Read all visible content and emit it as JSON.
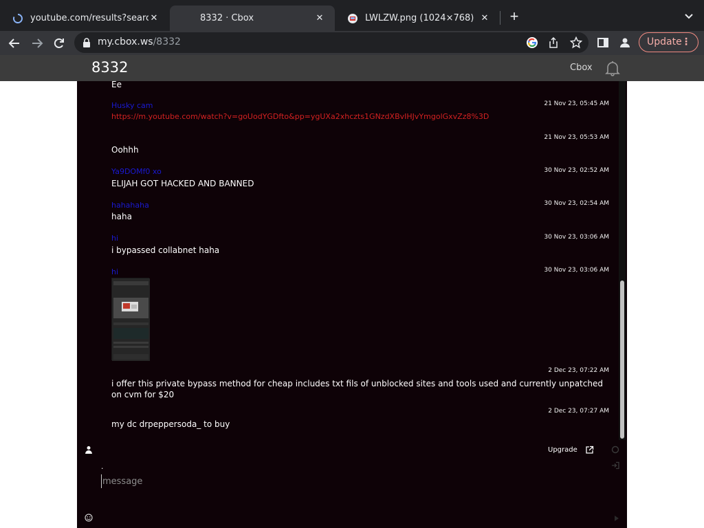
{
  "browser": {
    "tabs": [
      {
        "title": "youtube.com/results?search_q",
        "icon": "loading-spinner-icon",
        "active": false
      },
      {
        "title": "8332 · Cbox",
        "icon": "",
        "active": true
      },
      {
        "title": "LWLZW.png (1024×768)",
        "icon": "image-icon",
        "active": false
      }
    ],
    "url_host": "my.cbox.ws",
    "url_path": "/8332",
    "update_label": "Update"
  },
  "app": {
    "room_title": "8332",
    "brand": "Cbox"
  },
  "chat": {
    "top_partial_text": "Ee",
    "messages": [
      {
        "name": "Husky cam",
        "time": "21 Nov 23, 05:45 AM",
        "link": "https://m.youtube.com/watch?v=goUodYGDfto&pp=ygUXa2xhczts1GNzdXBvIHJvYmgolGxvZz8%3D"
      },
      {
        "name": "",
        "time": "21 Nov 23, 05:53 AM",
        "text": "Oohhh"
      },
      {
        "name": "Ya9DOMf0 xo",
        "time": "30 Nov 23, 02:52 AM",
        "text": "ELIJAH GOT HACKED AND BANNED"
      },
      {
        "name": "hahahaha",
        "time": "30 Nov 23, 02:54 AM",
        "text": "haha"
      },
      {
        "name": "hi",
        "time": "30 Nov 23, 03:06 AM",
        "text": "i bypassed collabnet haha"
      },
      {
        "name": "hi",
        "time": "30 Nov 23, 03:06 AM",
        "image": "screenshot-thumbnail"
      },
      {
        "name": "",
        "time": "2 Dec 23, 07:22 AM",
        "text": "i offer this private bypass method for cheap includes txt fils of unblocked sites and tools used and currently unpatched on cvm for $20"
      },
      {
        "name": "",
        "time": "2 Dec 23, 07:27 AM",
        "text": "my dc drpeppersoda_ to buy"
      }
    ],
    "upgrade_label": "Upgrade",
    "name_value": ".",
    "message_placeholder": "message"
  }
}
